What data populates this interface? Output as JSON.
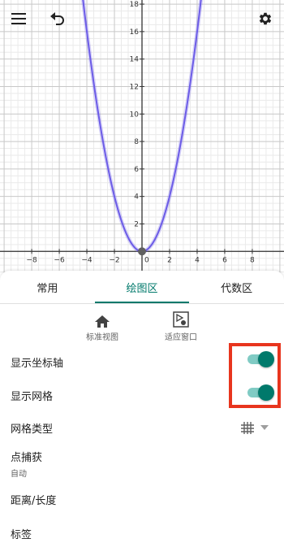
{
  "toolbar": {
    "menu_icon": "menu-icon",
    "undo_icon": "undo-icon",
    "settings_icon": "gear-icon"
  },
  "graph": {
    "function": "y = x^2",
    "x_tick_labels": [
      "−8",
      "−6",
      "−4",
      "−2",
      "0",
      "2",
      "4",
      "6",
      "8"
    ],
    "y_tick_labels": [
      "2",
      "4",
      "6",
      "8",
      "10",
      "12",
      "14",
      "16",
      "18"
    ],
    "x_range": [
      -10.3,
      10.3
    ],
    "y_range": [
      -1.7,
      18.3
    ],
    "major_step": 2,
    "minor_step": 0.5,
    "curve_color": "#6c5ce7",
    "point": {
      "x": 0,
      "y": 0,
      "color": "#616161"
    }
  },
  "tabs": {
    "items": [
      "常用",
      "绘图区",
      "代数区"
    ],
    "active_index": 1,
    "accent": "#00796b"
  },
  "view_buttons": {
    "standard": {
      "label": "标准视图",
      "icon": "home-icon"
    },
    "fit": {
      "label": "适应窗口",
      "icon": "fit-window-icon"
    }
  },
  "settings": {
    "show_axes": {
      "label": "显示坐标轴",
      "enabled": true
    },
    "show_grid": {
      "label": "显示网格",
      "enabled": true
    },
    "grid_type": {
      "label": "网格类型",
      "icon": "grid-icon"
    },
    "point_capture": {
      "label": "点捕获",
      "value": "自动"
    },
    "distance": {
      "label": "距离/长度"
    },
    "labels": {
      "label": "标签"
    }
  },
  "highlight_color": "#e8351e"
}
